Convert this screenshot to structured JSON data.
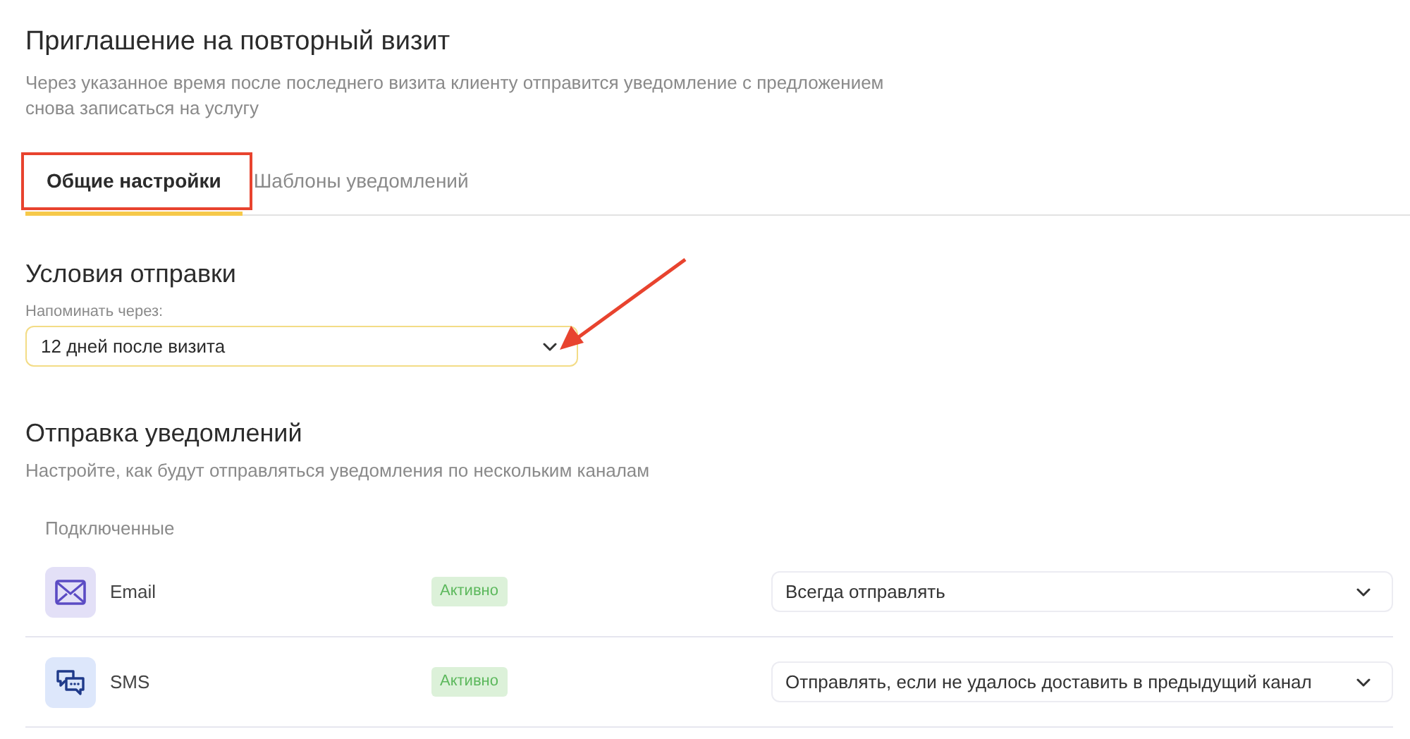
{
  "page": {
    "title": "Приглашение на повторный визит",
    "description": "Через указанное время после последнего визита клиенту отправится уведомление с предложением снова записаться на услугу"
  },
  "tabs": [
    {
      "label": "Общие настройки",
      "selected": true
    },
    {
      "label": "Шаблоны уведомлений",
      "selected": false
    }
  ],
  "conditions": {
    "title": "Условия отправки",
    "field_label": "Напоминать через:",
    "value": "12 дней после визита"
  },
  "notifications": {
    "title": "Отправка уведомлений",
    "description": "Настройте, как будут отправляться уведомления по нескольким каналам",
    "group_label": "Подключенные",
    "channels": [
      {
        "kind": "email",
        "name": "Email",
        "status": "Активно",
        "rule": "Всегда отправлять"
      },
      {
        "kind": "sms",
        "name": "SMS",
        "status": "Активно",
        "rule": "Отправлять, если не удалось доставить в предыдущий канал"
      }
    ]
  }
}
